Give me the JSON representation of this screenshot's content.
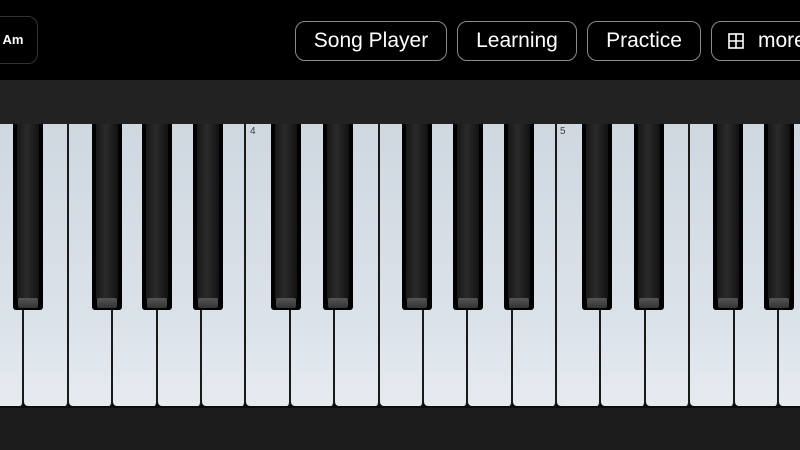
{
  "topbar": {
    "key_label": "Am",
    "buttons": [
      {
        "label": "Song Player"
      },
      {
        "label": "Learning"
      },
      {
        "label": "Practice"
      },
      {
        "label": "more",
        "icon": "grid-icon"
      }
    ]
  },
  "keyboard": {
    "octave_labels": [
      "4",
      "5"
    ],
    "colors": {
      "white_key": "#dbe2ea",
      "black_key": "#000000",
      "background": "#1c1c1c"
    }
  }
}
